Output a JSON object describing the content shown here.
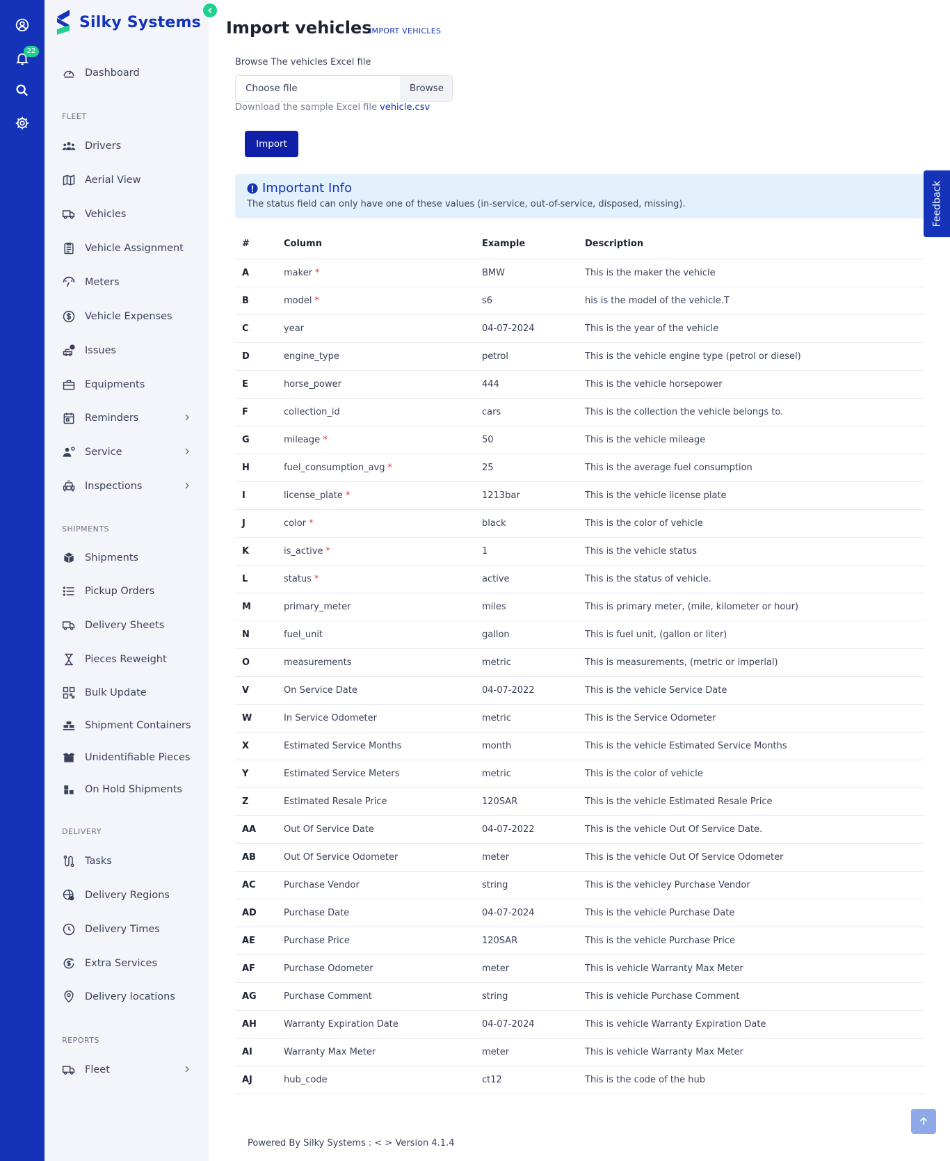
{
  "brand": {
    "name": "Silky Systems"
  },
  "rail": {
    "notification_count": "22"
  },
  "sidebar": {
    "dashboard": "Dashboard",
    "sections": {
      "fleet": "FLEET",
      "shipments": "SHIPMENTS",
      "delivery": "DELIVERY",
      "reports": "REPORTS"
    },
    "fleet_items": [
      "Drivers",
      "Aerial View",
      "Vehicles",
      "Vehicle Assignment",
      "Meters",
      "Vehicle Expenses",
      "Issues",
      "Equipments",
      "Reminders",
      "Service",
      "Inspections"
    ],
    "shipment_items": [
      "Shipments",
      "Pickup Orders",
      "Delivery Sheets",
      "Pieces Reweight",
      "Bulk Update",
      "Shipment Containers",
      "Unidentifiable Pieces",
      "On Hold Shipments"
    ],
    "delivery_items": [
      "Tasks",
      "Delivery Regions",
      "Delivery Times",
      "Extra Services",
      "Delivery locations"
    ],
    "report_items": [
      "Fleet"
    ]
  },
  "page": {
    "title": "Import vehicles",
    "breadcrumb": "IMPORT VEHICLES",
    "file_label": "Browse The vehicles Excel file",
    "file_placeholder": "Choose file",
    "browse_label": "Browse",
    "sample_text": "Download the sample Excel file",
    "sample_link": "vehicle.csv",
    "import_label": "Import",
    "info_title": "Important Info",
    "info_text": "The status field can only have one of these values (in-service, out-of-service, disposed, missing)."
  },
  "table": {
    "headers": [
      "#",
      "Column",
      "Example",
      "Description"
    ],
    "rows": [
      {
        "id": "A",
        "column": "maker",
        "required": true,
        "example": "BMW",
        "description": "This is the maker the vehicle"
      },
      {
        "id": "B",
        "column": "model",
        "required": true,
        "example": "s6",
        "description": "his is the model of the vehicle.T"
      },
      {
        "id": "C",
        "column": "year",
        "required": false,
        "example": "04-07-2024",
        "description": "This is the year of the vehicle"
      },
      {
        "id": "D",
        "column": "engine_type",
        "required": false,
        "example": "petrol",
        "description": "This is the vehicle engine type (petrol or diesel)"
      },
      {
        "id": "E",
        "column": "horse_power",
        "required": false,
        "example": "444",
        "description": "This is the vehicle horsepower"
      },
      {
        "id": "F",
        "column": "collection_id",
        "required": false,
        "example": "cars",
        "description": "This is the collection the vehicle belongs to."
      },
      {
        "id": "G",
        "column": "mileage",
        "required": true,
        "example": "50",
        "description": "This is the vehicle mileage"
      },
      {
        "id": "H",
        "column": "fuel_consumption_avg",
        "required": true,
        "example": "25",
        "description": "This is the average fuel consumption"
      },
      {
        "id": "I",
        "column": "license_plate",
        "required": true,
        "example": "1213bar",
        "description": "This is the vehicle license plate"
      },
      {
        "id": "J",
        "column": "color",
        "required": true,
        "example": "black",
        "description": "This is the color of vehicle"
      },
      {
        "id": "K",
        "column": "is_active",
        "required": true,
        "example": "1",
        "description": "This is the vehicle status"
      },
      {
        "id": "L",
        "column": "status",
        "required": true,
        "example": "active",
        "description": "This is the status of vehicle."
      },
      {
        "id": "M",
        "column": "primary_meter",
        "required": false,
        "example": "miles",
        "description": "This is primary meter, (mile, kilometer or hour)"
      },
      {
        "id": "N",
        "column": "fuel_unit",
        "required": false,
        "example": "gallon",
        "description": "This is fuel unit, (gallon or liter)"
      },
      {
        "id": "O",
        "column": "measurements",
        "required": false,
        "example": "metric",
        "description": "This is measurements, (metric or imperial)"
      },
      {
        "id": "V",
        "column": "On Service Date",
        "required": false,
        "example": "04-07-2022",
        "description": "This is the vehicle Service Date"
      },
      {
        "id": "W",
        "column": "In Service Odometer",
        "required": false,
        "example": "metric",
        "description": "This is the Service Odometer"
      },
      {
        "id": "X",
        "column": "Estimated Service Months",
        "required": false,
        "example": "month",
        "description": "This is the vehicle Estimated Service Months"
      },
      {
        "id": "Y",
        "column": "Estimated Service Meters",
        "required": false,
        "example": "metric",
        "description": "This is the color of vehicle"
      },
      {
        "id": "Z",
        "column": "Estimated Resale Price",
        "required": false,
        "example": "120SAR",
        "description": "This is the vehicle Estimated Resale Price"
      },
      {
        "id": "AA",
        "column": "Out Of Service Date",
        "required": false,
        "example": "04-07-2022",
        "description": "This is the vehicle Out Of Service Date."
      },
      {
        "id": "AB",
        "column": "Out Of Service Odometer",
        "required": false,
        "example": "meter",
        "description": "This is the vehicle Out Of Service Odometer"
      },
      {
        "id": "AC",
        "column": "Purchase Vendor",
        "required": false,
        "example": "string",
        "description": "This is the vehicley Purchase Vendor"
      },
      {
        "id": "AD",
        "column": "Purchase Date",
        "required": false,
        "example": "04-07-2024",
        "description": "This is the vehicle Purchase Date"
      },
      {
        "id": "AE",
        "column": "Purchase Price",
        "required": false,
        "example": "120SAR",
        "description": "This is the vehicle Purchase Price"
      },
      {
        "id": "AF",
        "column": "Purchase Odometer",
        "required": false,
        "example": "meter",
        "description": "This is vehicle Warranty Max Meter"
      },
      {
        "id": "AG",
        "column": "Purchase Comment",
        "required": false,
        "example": "string",
        "description": "This is vehicle Purchase Comment"
      },
      {
        "id": "AH",
        "column": "Warranty Expiration Date",
        "required": false,
        "example": "04-07-2024",
        "description": "This is vehicle Warranty Expiration Date"
      },
      {
        "id": "AI",
        "column": "Warranty Max Meter",
        "required": false,
        "example": "meter",
        "description": "This is vehicle Warranty Max Meter"
      },
      {
        "id": "AJ",
        "column": "hub_code",
        "required": false,
        "example": "ct12",
        "description": "This is the code of the hub"
      }
    ]
  },
  "feedback_label": "Feedback",
  "footer": "Powered By Silky Systems : < > Version 4.1.4",
  "colors": {
    "primary": "#1433b8",
    "accent": "#1fd18e",
    "info_bg": "#e3f1fd",
    "required": "#e53935"
  }
}
